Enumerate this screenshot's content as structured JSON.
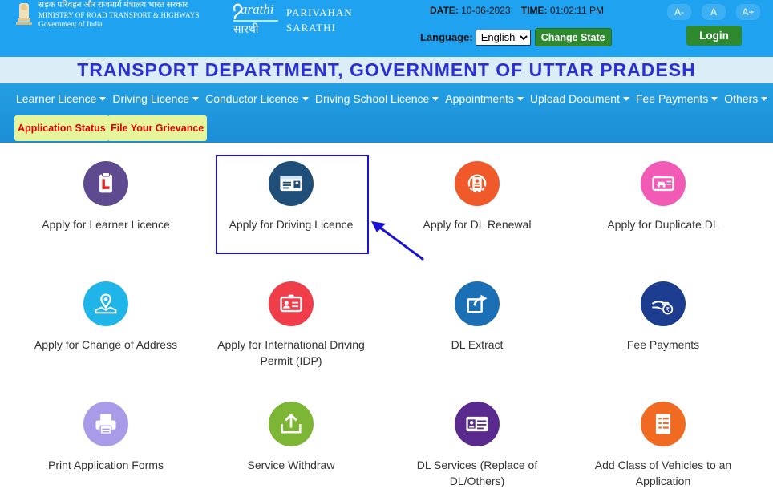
{
  "header": {
    "ministry_line1": "सड़क परिवहन और राजमार्ग मंत्रालय भारत सरकार",
    "ministry_line2": "MINISTRY OF ROAD TRANSPORT & HIGHWAYS",
    "ministry_line3": "Government of India",
    "brand_line1": "PARIVAHAN",
    "brand_line2": "SARATHI",
    "date_label": "DATE:",
    "date_value": "10-06-2023",
    "time_label": "TIME:",
    "time_value": "01:02:11 PM",
    "language_label": "Language:",
    "language_selected": "English",
    "change_state_label": "Change State",
    "font_decrease": "A-",
    "font_normal": "A",
    "font_increase": "A+",
    "login_label": "Login",
    "background_color": "#1fa2f0"
  },
  "department_title": "TRANSPORT DEPARTMENT, GOVERNMENT OF UTTAR PRADESH",
  "nav": {
    "items": [
      {
        "label": "Learner Licence",
        "icon": "caret-down-icon"
      },
      {
        "label": "Driving Licence",
        "icon": "caret-down-icon"
      },
      {
        "label": "Conductor Licence",
        "icon": "caret-down-icon"
      },
      {
        "label": "Driving School Licence",
        "icon": "caret-down-icon"
      },
      {
        "label": "Appointments",
        "icon": "caret-down-icon"
      },
      {
        "label": "Upload Document",
        "icon": "caret-down-icon"
      },
      {
        "label": "Fee Payments",
        "icon": "caret-down-icon"
      },
      {
        "label": "Others",
        "icon": "caret-down-icon"
      }
    ],
    "application_status": "Application Status",
    "file_grievance": "File Your Grievance"
  },
  "services": [
    {
      "label": "Apply for Learner Licence",
      "icon": "learner-licence-icon",
      "color": "#5e4a8f"
    },
    {
      "label": "Apply for Driving Licence",
      "icon": "driving-licence-card-icon",
      "color": "#1f4e79",
      "highlighted": true
    },
    {
      "label": "Apply for DL Renewal",
      "icon": "dl-renewal-icon",
      "color": "#f05a2a"
    },
    {
      "label": "Apply for Duplicate DL",
      "icon": "duplicate-dl-icon",
      "color": "#f15bb5"
    },
    {
      "label": "Apply for Change of Address",
      "icon": "map-pin-icon",
      "color": "#1fb5e8"
    },
    {
      "label": "Apply for International Driving Permit (IDP)",
      "icon": "id-badge-icon",
      "color": "#ef3e4a"
    },
    {
      "label": "DL Extract",
      "icon": "share-export-icon",
      "color": "#1a6fb5"
    },
    {
      "label": "Fee Payments",
      "icon": "rupee-hand-icon",
      "color": "#1c3d8f"
    },
    {
      "label": "Print Application Forms",
      "icon": "printer-icon",
      "color": "#a99be8"
    },
    {
      "label": "Service Withdraw",
      "icon": "upload-tray-icon",
      "color": "#7db534"
    },
    {
      "label": "DL Services (Replace of DL/Others)",
      "icon": "id-card-icon",
      "color": "#5b2a8f"
    },
    {
      "label": "Add Class of Vehicles to an Application",
      "icon": "document-list-icon",
      "color": "#f06a22"
    }
  ],
  "annotation_color": "#1a13d6"
}
